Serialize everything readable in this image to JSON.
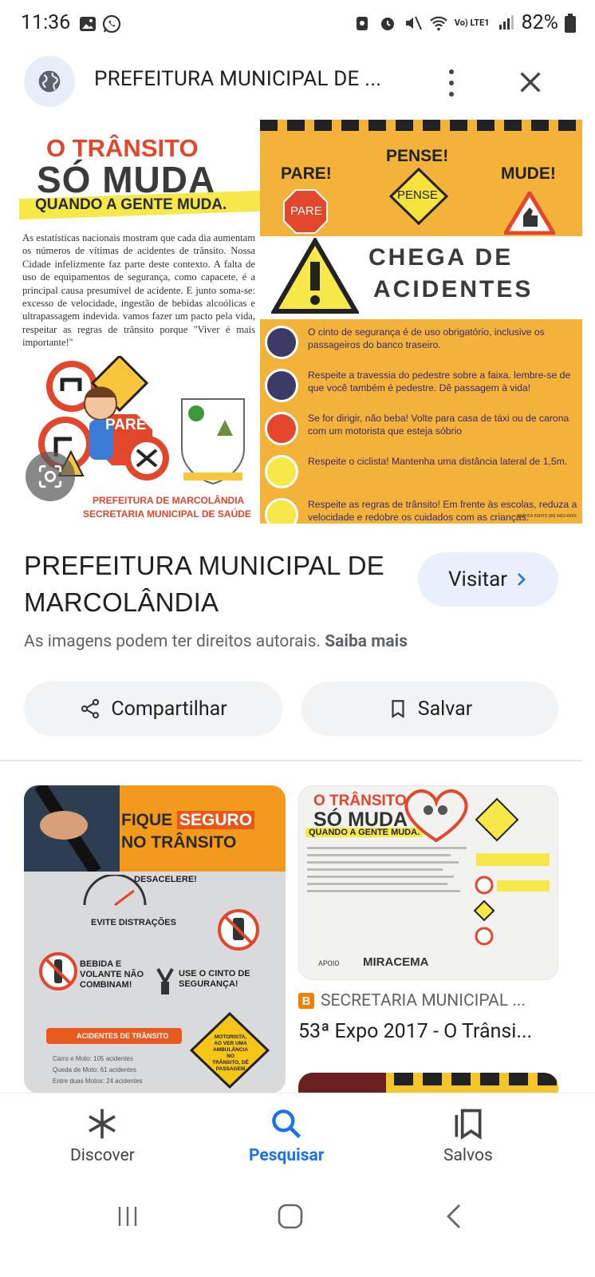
{
  "status_bar": {
    "time": "11:36",
    "battery": "82%",
    "network": "Vo) LTE1"
  },
  "top_bar": {
    "title": "PREFEITURA MUNICIPAL DE ..."
  },
  "hero": {
    "title_line1": "O TRÂNSITO",
    "title_line2": "SÓ MUDA",
    "subtitle": "QUANDO A GENTE MUDA.",
    "body": "As estatísticas nacionais mostram que cada dia aumentam os números de vítimas de acidentes de trânsito. Nossa Cidade infelizmente faz parte deste contexto. A falta de uso de equipamentos de segurança, como capacete, é a principal causa presumível de acidente. E junto soma-se: excesso de velocidade, ingestão de bebidas alcoólicas e ultrapassagem indevida. vamos fazer um pacto pela vida, respeitar as regras de trânsito porque ''Viver é mais importante!''",
    "pare": "PARE!",
    "pense": "PENSE!",
    "mude": "MUDE!",
    "sign_pare": "PARE",
    "sign_pense": "PENSE",
    "sign_pare_small": "PARE",
    "chega1": "CHEGA DE",
    "chega2": "ACIDENTES",
    "rules": [
      "O cinto de segurança é de uso obrigatório, inclusive os passageiros do banco traseiro.",
      "Respeite a travessia do pedestre sobre a faixa. lembre-se de que você também é pedestre. Dê passagem à vida!",
      "Se for dirigir, não beba! Volte para casa de táxi ou de carona com um motorista que esteja sóbrio",
      "Respeite o ciclista! Mantenha uma distância lateral de 1,5m.",
      "Respeite as regras de trânsito! Em frente às escolas, reduza a velocidade e redobre os cuidados com as crianças."
    ],
    "pref1": "PREFEITURA DE MARCOLÂNDIA",
    "pref2": "SECRETARIA MUNICIPAL DE SAÚDE",
    "credit": "GRÁFICA ESPITO (89) 3422-XXXX"
  },
  "result": {
    "title": "PREFEITURA MUNICIPAL DE MARCOLÂNDIA",
    "visit_label": "Visitar",
    "copyright_text": "As imagens podem ter direitos autorais.",
    "learn_more": "Saiba mais",
    "share_label": "Compartilhar",
    "save_label": "Salvar"
  },
  "related": {
    "card1": {
      "title_a": "FIQUE",
      "title_b": "SEGURO",
      "title_c": "NO TRÂNSITO",
      "desacelere": "DESACELERE!",
      "evite": "EVITE DISTRAÇÕES",
      "bebida": "BEBIDA E VOLANTE NÃO COMBINAM!",
      "cinto": "USE O CINTO DE SEGURANÇA!",
      "acidentes": "ACIDENTES DE TRÂNSITO",
      "motorista": "MOTORISTA, AO VER UMA AMBULÂNCIA NO TRÂNSITO, DÊ PASSAGEM",
      "stat1": "Carro e Moto: 105 acidentes",
      "stat2": "Queda de Moto: 61 acidentes",
      "stat3": "Entre duas Motos: 24 acidentes"
    },
    "card2": {
      "title_a": "O TRÂNSITO",
      "title_b": "SÓ MUDA",
      "title_c": "QUANDO A GENTE MUDA.",
      "apoio": "APOIO",
      "miracema": "MIRACEMA",
      "source": "SECRETARIA MUNICIPAL ...",
      "result_title": "53ª Expo 2017 - O Trânsi..."
    }
  },
  "bottom_nav": {
    "discover": "Discover",
    "search": "Pesquisar",
    "saved": "Salvos"
  },
  "colors": {
    "accent": "#1a73e8",
    "hero_orange": "#f3b23a",
    "hero_red": "#e2462b"
  }
}
